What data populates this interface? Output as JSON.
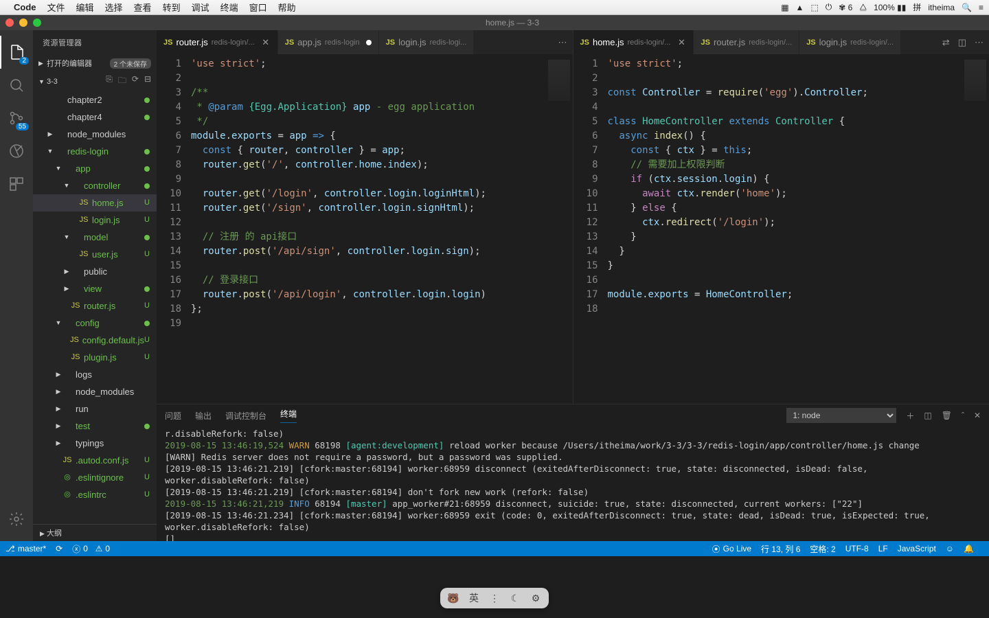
{
  "mac": {
    "app": "Code",
    "menus": [
      "文件",
      "编辑",
      "选择",
      "查看",
      "转到",
      "调试",
      "终端",
      "窗口",
      "帮助"
    ],
    "right": [
      "6",
      "100%",
      "itheima"
    ],
    "wifi": "⌃",
    "time": ""
  },
  "window": {
    "title": "home.js — 3-3"
  },
  "activity": {
    "explorer_badge": "2",
    "scm_badge": "55"
  },
  "sidebar": {
    "title": "资源管理器",
    "openEditors": "打开的编辑器",
    "openEditorsCount": "2 个未保存",
    "root": "3-3",
    "items": [
      {
        "kind": "folder",
        "label": "chapter2",
        "indent": 1,
        "dot": "g"
      },
      {
        "kind": "folder",
        "label": "chapter4",
        "indent": 1,
        "dot": "g"
      },
      {
        "kind": "folder",
        "label": "node_modules",
        "indent": 1,
        "arrow": "▶"
      },
      {
        "kind": "folder",
        "label": "redis-login",
        "indent": 1,
        "dot": "g",
        "arrow": "▼",
        "green": true
      },
      {
        "kind": "folder",
        "label": "app",
        "indent": 2,
        "dot": "g",
        "arrow": "▼",
        "green": true
      },
      {
        "kind": "folder",
        "label": "controller",
        "indent": 3,
        "dot": "g",
        "arrow": "▼",
        "green": true
      },
      {
        "kind": "js",
        "label": "home.js",
        "indent": 4,
        "status": "U",
        "selected": true,
        "green": true
      },
      {
        "kind": "js",
        "label": "login.js",
        "indent": 4,
        "status": "U",
        "green": true
      },
      {
        "kind": "folder",
        "label": "model",
        "indent": 3,
        "dot": "g",
        "arrow": "▼",
        "green": true
      },
      {
        "kind": "js",
        "label": "user.js",
        "indent": 4,
        "status": "U",
        "green": true
      },
      {
        "kind": "folder",
        "label": "public",
        "indent": 3,
        "arrow": "▶"
      },
      {
        "kind": "folder",
        "label": "view",
        "indent": 3,
        "dot": "g",
        "arrow": "▶",
        "green": true
      },
      {
        "kind": "js",
        "label": "router.js",
        "indent": 3,
        "status": "U",
        "green": true
      },
      {
        "kind": "folder",
        "label": "config",
        "indent": 2,
        "dot": "g",
        "arrow": "▼",
        "green": true
      },
      {
        "kind": "js",
        "label": "config.default.js",
        "indent": 3,
        "status": "U",
        "green": true
      },
      {
        "kind": "js",
        "label": "plugin.js",
        "indent": 3,
        "status": "U",
        "green": true
      },
      {
        "kind": "folder",
        "label": "logs",
        "indent": 2,
        "arrow": "▶"
      },
      {
        "kind": "folder",
        "label": "node_modules",
        "indent": 2,
        "arrow": "▶"
      },
      {
        "kind": "folder",
        "label": "run",
        "indent": 2,
        "arrow": "▶"
      },
      {
        "kind": "folder",
        "label": "test",
        "indent": 2,
        "dot": "g",
        "arrow": "▶",
        "green": true
      },
      {
        "kind": "folder",
        "label": "typings",
        "indent": 2,
        "arrow": "▶"
      },
      {
        "kind": "js",
        "label": ".autod.conf.js",
        "indent": 2,
        "status": "U",
        "green": true
      },
      {
        "kind": "file",
        "label": ".eslintignore",
        "indent": 2,
        "status": "U",
        "green": true
      },
      {
        "kind": "file",
        "label": ".eslintrc",
        "indent": 2,
        "status": "U",
        "green": true
      }
    ],
    "outline": "大纲"
  },
  "tabsLeft": [
    {
      "name": "router.js",
      "path": "redis-login/...",
      "active": true,
      "close": true
    },
    {
      "name": "app.js",
      "path": "redis-login",
      "modified": true
    },
    {
      "name": "login.js",
      "path": "redis-logi..."
    }
  ],
  "tabsRight": [
    {
      "name": "home.js",
      "path": "redis-login/...",
      "active": true,
      "close": true
    },
    {
      "name": "router.js",
      "path": "redis-login/..."
    },
    {
      "name": "login.js",
      "path": "redis-login/..."
    }
  ],
  "leftCode": {
    "lines": 19
  },
  "rightCode": {
    "lines": 18
  },
  "panel": {
    "tabs": [
      "问题",
      "输出",
      "调试控制台",
      "终端"
    ],
    "active": 3,
    "select": "1: node"
  },
  "terminal": [
    "r.disableRefork: false)",
    {
      "date": "2019-08-15 13:46:19,524",
      "lvl": "WARN",
      "pid": "68198",
      "tag": "[agent:development]",
      "msg": "reload worker because /Users/itheima/work/3-3/3-3/redis-login/app/controller/home.js change"
    },
    "[WARN] Redis server does not require a password, but a password was supplied.",
    "[2019-08-15 13:46:21.219] [cfork:master:68194] worker:68959 disconnect (exitedAfterDisconnect: true, state: disconnected, isDead: false, worker.disableRefork: false)",
    "[2019-08-15 13:46:21.219] [cfork:master:68194] don't fork new work (refork: false)",
    {
      "date": "2019-08-15 13:46:21,219",
      "lvl": "INFO",
      "pid": "68194",
      "tag": "[master]",
      "msg": "app_worker#21:68959 disconnect, suicide: true, state: disconnected, current workers: [\"22\"]"
    },
    "[2019-08-15 13:46:21.234] [cfork:master:68194] worker:68959 exit (code: 0, exitedAfterDisconnect: true, state: dead, isDead: true, isExpected: true, worker.disableRefork: false)",
    "[]"
  ],
  "status": {
    "branch": "master*",
    "errors": "0",
    "warnings": "0",
    "golive": "Go Live",
    "ln": "行 13, 列 6",
    "spaces": "空格: 2",
    "enc": "UTF-8",
    "eol": "LF",
    "lang": "JavaScript"
  },
  "dock": [
    "英"
  ]
}
